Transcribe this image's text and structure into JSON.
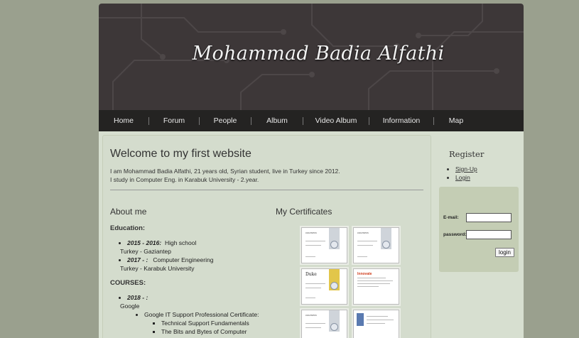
{
  "site": {
    "title": "Mohammad Badia Alfathi"
  },
  "nav": {
    "items": [
      "Home",
      "Forum",
      "People",
      "Album",
      "Video Album",
      "Information",
      "Map"
    ]
  },
  "main": {
    "welcome_title": "Welcome to my first website",
    "intro_line1": "I am Mohammad Badia Alfathi, 21 years old, Syrian student, live in Turkey since 2012.",
    "intro_line2": "I study in Computer Eng. in Karabuk University - 2.year.",
    "about_title": "About me",
    "education_title": "Education:",
    "education": [
      {
        "years": "2015 - 2016:",
        "text": "High school",
        "place": "Turkey - Gaziantep"
      },
      {
        "years": "2017 - :",
        "text": "Computer Engineering",
        "place": "Turkey - Karabuk University"
      }
    ],
    "courses_title": "COURSES:",
    "courses": {
      "years": "2018 - :",
      "provider": "Google",
      "program": "Google IT Support Professional Certificate:",
      "items": [
        "Technical Support Fundamentals",
        "The Bits and Bytes of Computer"
      ]
    },
    "certificates_title": "My Certificates",
    "certificates": [
      {
        "header": "coursera"
      },
      {
        "header": "coursera"
      },
      {
        "header": "Duke"
      },
      {
        "header": "Innovate"
      },
      {
        "header": "coursera"
      },
      {
        "header": ""
      }
    ]
  },
  "sidebar": {
    "register_title": "Register",
    "links": [
      "Sign-Up",
      "Login"
    ],
    "email_label": "E-mail:",
    "password_label": "password:",
    "login_button": "login"
  }
}
